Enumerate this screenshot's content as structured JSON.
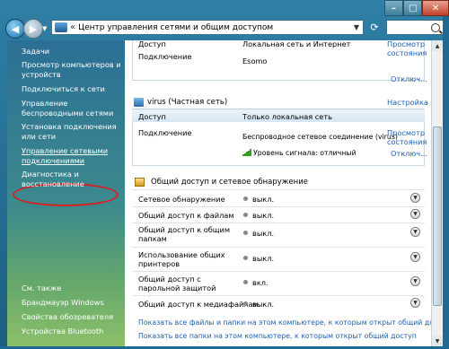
{
  "window": {
    "address_text": "Центр управления сетями и общим доступом"
  },
  "left_pane": {
    "tasks_title": "Задачи",
    "links": [
      "Просмотр компьютеров и устройств",
      "Подключиться к сети",
      "Управление беспроводными сетями",
      "Установка подключения или сети",
      "Управление сетевыми подключениями",
      "Диагностика и восстановление"
    ],
    "see_also_title": "См. также",
    "see_also": [
      "Брандмауэр Windows",
      "Свойства обозревателя",
      "Устройства Bluetooth"
    ]
  },
  "network1": {
    "access_label": "Доступ",
    "access_value": "Локальная сеть и Интернет",
    "connection_label": "Подключение",
    "connection_value": "Esomo",
    "view_status": "Просмотр состояния",
    "disconnect": "Отключ..."
  },
  "network2": {
    "name": "virus (Частная сеть)",
    "configure": "Настройка",
    "access_label": "Доступ",
    "access_value": "Только локальная сеть",
    "connection_label": "Подключение",
    "connection_value": "Беспроводное сетевое соединение (virus)",
    "signal": "Уровень сигнала: отличный",
    "view_status": "Просмотр состояния",
    "disconnect": "Отключ..."
  },
  "sharing": {
    "title": "Общий доступ и сетевое обнаружение",
    "rows": [
      {
        "label": "Сетевое обнаружение",
        "value": "выкл."
      },
      {
        "label": "Общий доступ к файлам",
        "value": "выкл."
      },
      {
        "label": "Общий доступ к общим папкам",
        "value": "выкл."
      },
      {
        "label": "Использование общих принтеров",
        "value": "выкл."
      },
      {
        "label": "Общий доступ с парольной защитой",
        "value": "вкл."
      },
      {
        "label": "Общий доступ к медиафайлам",
        "value": "выкл."
      }
    ]
  },
  "bottom_links": [
    "Показать все файлы и папки на этом компьютере, к которым открыт общий доступ",
    "Показать все папки на этом компьютере, к которым открыт общий доступ"
  ],
  "colors": {
    "link": "#1d5fb3",
    "signal": "#2fa11f",
    "highlight_circle": "#d91f1f"
  }
}
